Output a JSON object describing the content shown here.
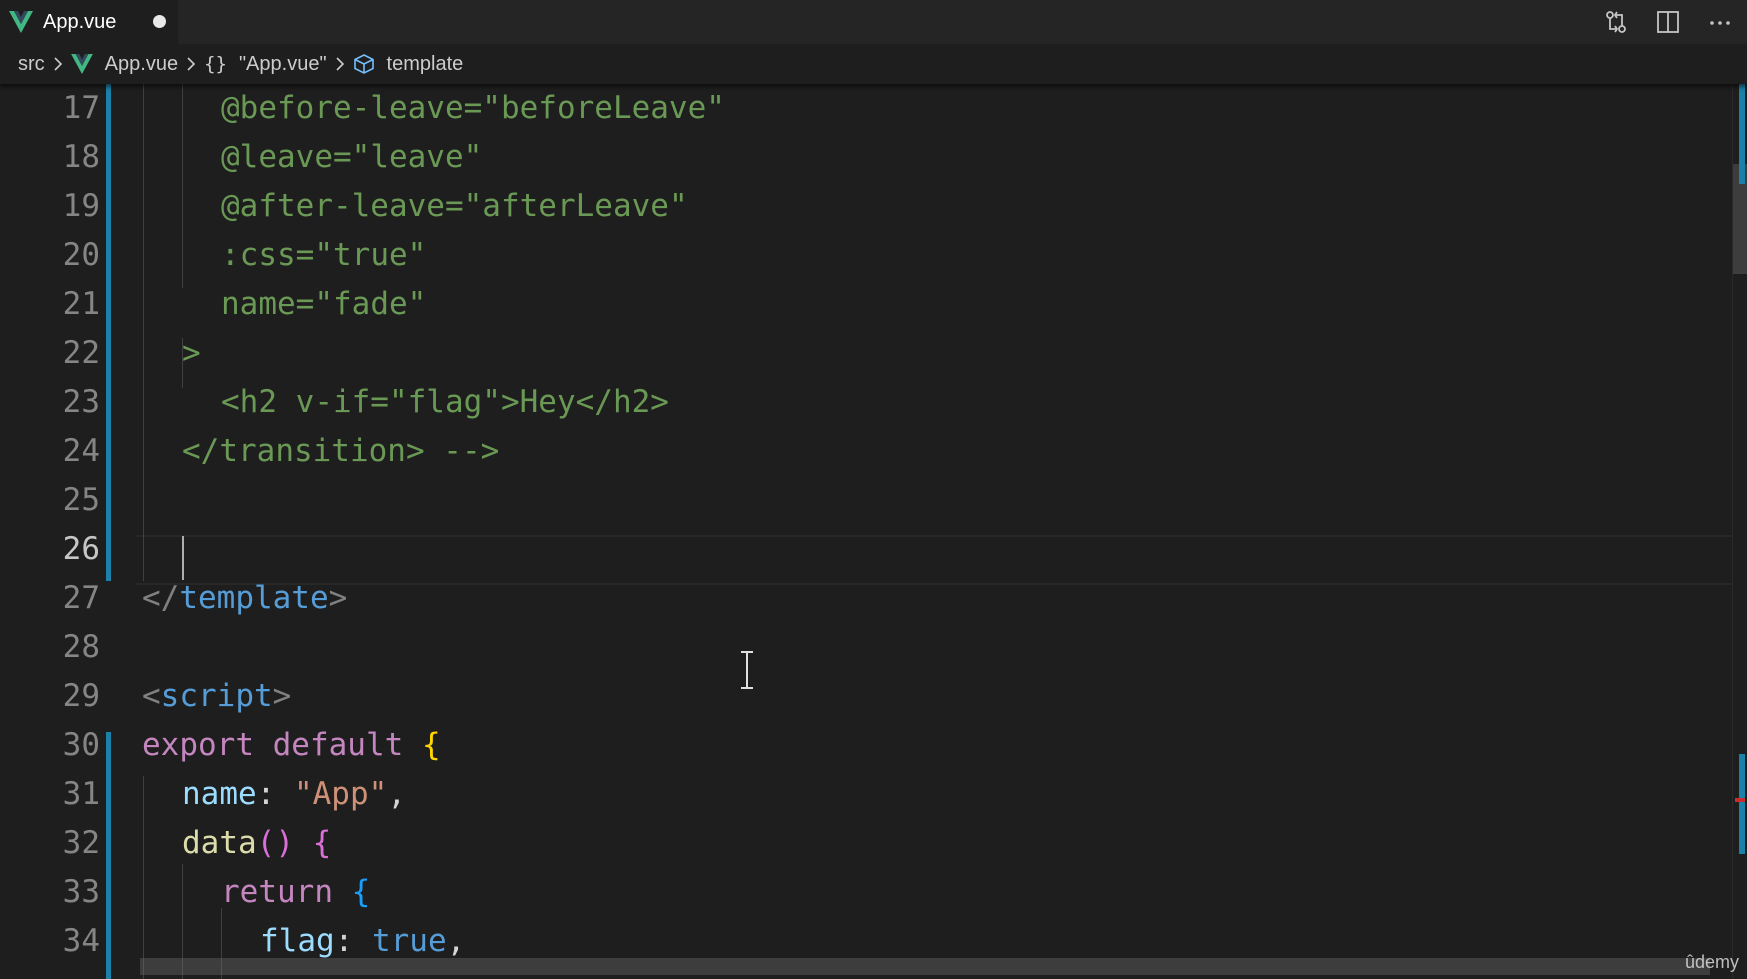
{
  "tab": {
    "label": "App.vue",
    "dirty": true,
    "icon": "vue-logo-icon"
  },
  "tab_actions": [
    "open-changes-icon",
    "split-editor-icon",
    "more-actions-icon"
  ],
  "breadcrumb": {
    "src": "src",
    "file": "App.vue",
    "braces": "{}",
    "component": "\"App.vue\"",
    "section": "template"
  },
  "colors": {
    "background": "#1e1e1e",
    "tabbar": "#252526",
    "diff_bar": "#1b81a8",
    "attr_green": "#6a9955",
    "string": "#ce9178",
    "tag": "#569cd6",
    "keyword": "#c586c0",
    "property": "#9cdcfe",
    "function": "#dcdcaa"
  },
  "editor": {
    "line_numbers": [
      "17",
      "18",
      "19",
      "20",
      "21",
      "22",
      "23",
      "24",
      "25",
      "26",
      "27",
      "28",
      "29",
      "30",
      "31",
      "32",
      "33",
      "34"
    ],
    "active_line": "26",
    "lines": {
      "l17": {
        "a": "@before-leave=",
        "b": "\"beforeLeave\""
      },
      "l18": {
        "a": "@leave=",
        "b": "\"leave\""
      },
      "l19": {
        "a": "@after-leave=",
        "b": "\"afterLeave\""
      },
      "l20": {
        "a": ":css=",
        "b": "\"true\""
      },
      "l21": {
        "a": "name=",
        "b": "\"fade\""
      },
      "l22": {
        "a": ">"
      },
      "l23": {
        "a": "<h2 v-if=",
        "b": "\"flag\"",
        "c": ">Hey</h2>"
      },
      "l24": {
        "a": "</transition> -->"
      },
      "l27": {
        "open": "</",
        "tag": "template",
        "close": ">"
      },
      "l29": {
        "open": "<",
        "tag": "script",
        "close": ">"
      },
      "l30": {
        "kw": "export default ",
        "brace": "{"
      },
      "l31": {
        "prop": "name",
        "colon": ": ",
        "str": "\"App\"",
        "comma": ","
      },
      "l32": {
        "fn": "data",
        "parens": "()",
        "space": " ",
        "brace": "{"
      },
      "l33": {
        "kw": "return ",
        "brace": "{"
      },
      "l34": {
        "prop": "flag",
        "colon": ": ",
        "bool": "true",
        "comma": ","
      }
    }
  },
  "watermark": "ûdemy"
}
